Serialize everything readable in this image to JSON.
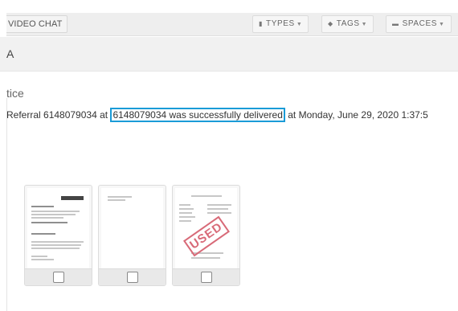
{
  "toolbar": {
    "video_chat_label": "VIDEO CHAT",
    "types": {
      "icon": "file-icon",
      "label": "TYPES"
    },
    "tags": {
      "icon": "tag-icon",
      "label": "TAGS"
    },
    "spaces": {
      "icon": "folder-icon",
      "label": "SPACES"
    }
  },
  "row_a": {
    "label": "A"
  },
  "section": {
    "title": "tice"
  },
  "notice": {
    "prefix": "Referral 6148079034 at ",
    "highlight": "6148079034 was successfully delivered",
    "suffix": " at Monday, June 29, 2020 1:37:5"
  },
  "thumbnails": [
    {
      "stamp": ""
    },
    {
      "stamp": ""
    },
    {
      "stamp": "USED"
    }
  ],
  "colors": {
    "highlight_border": "#1a9bd7",
    "stamp": "#d86a78"
  }
}
